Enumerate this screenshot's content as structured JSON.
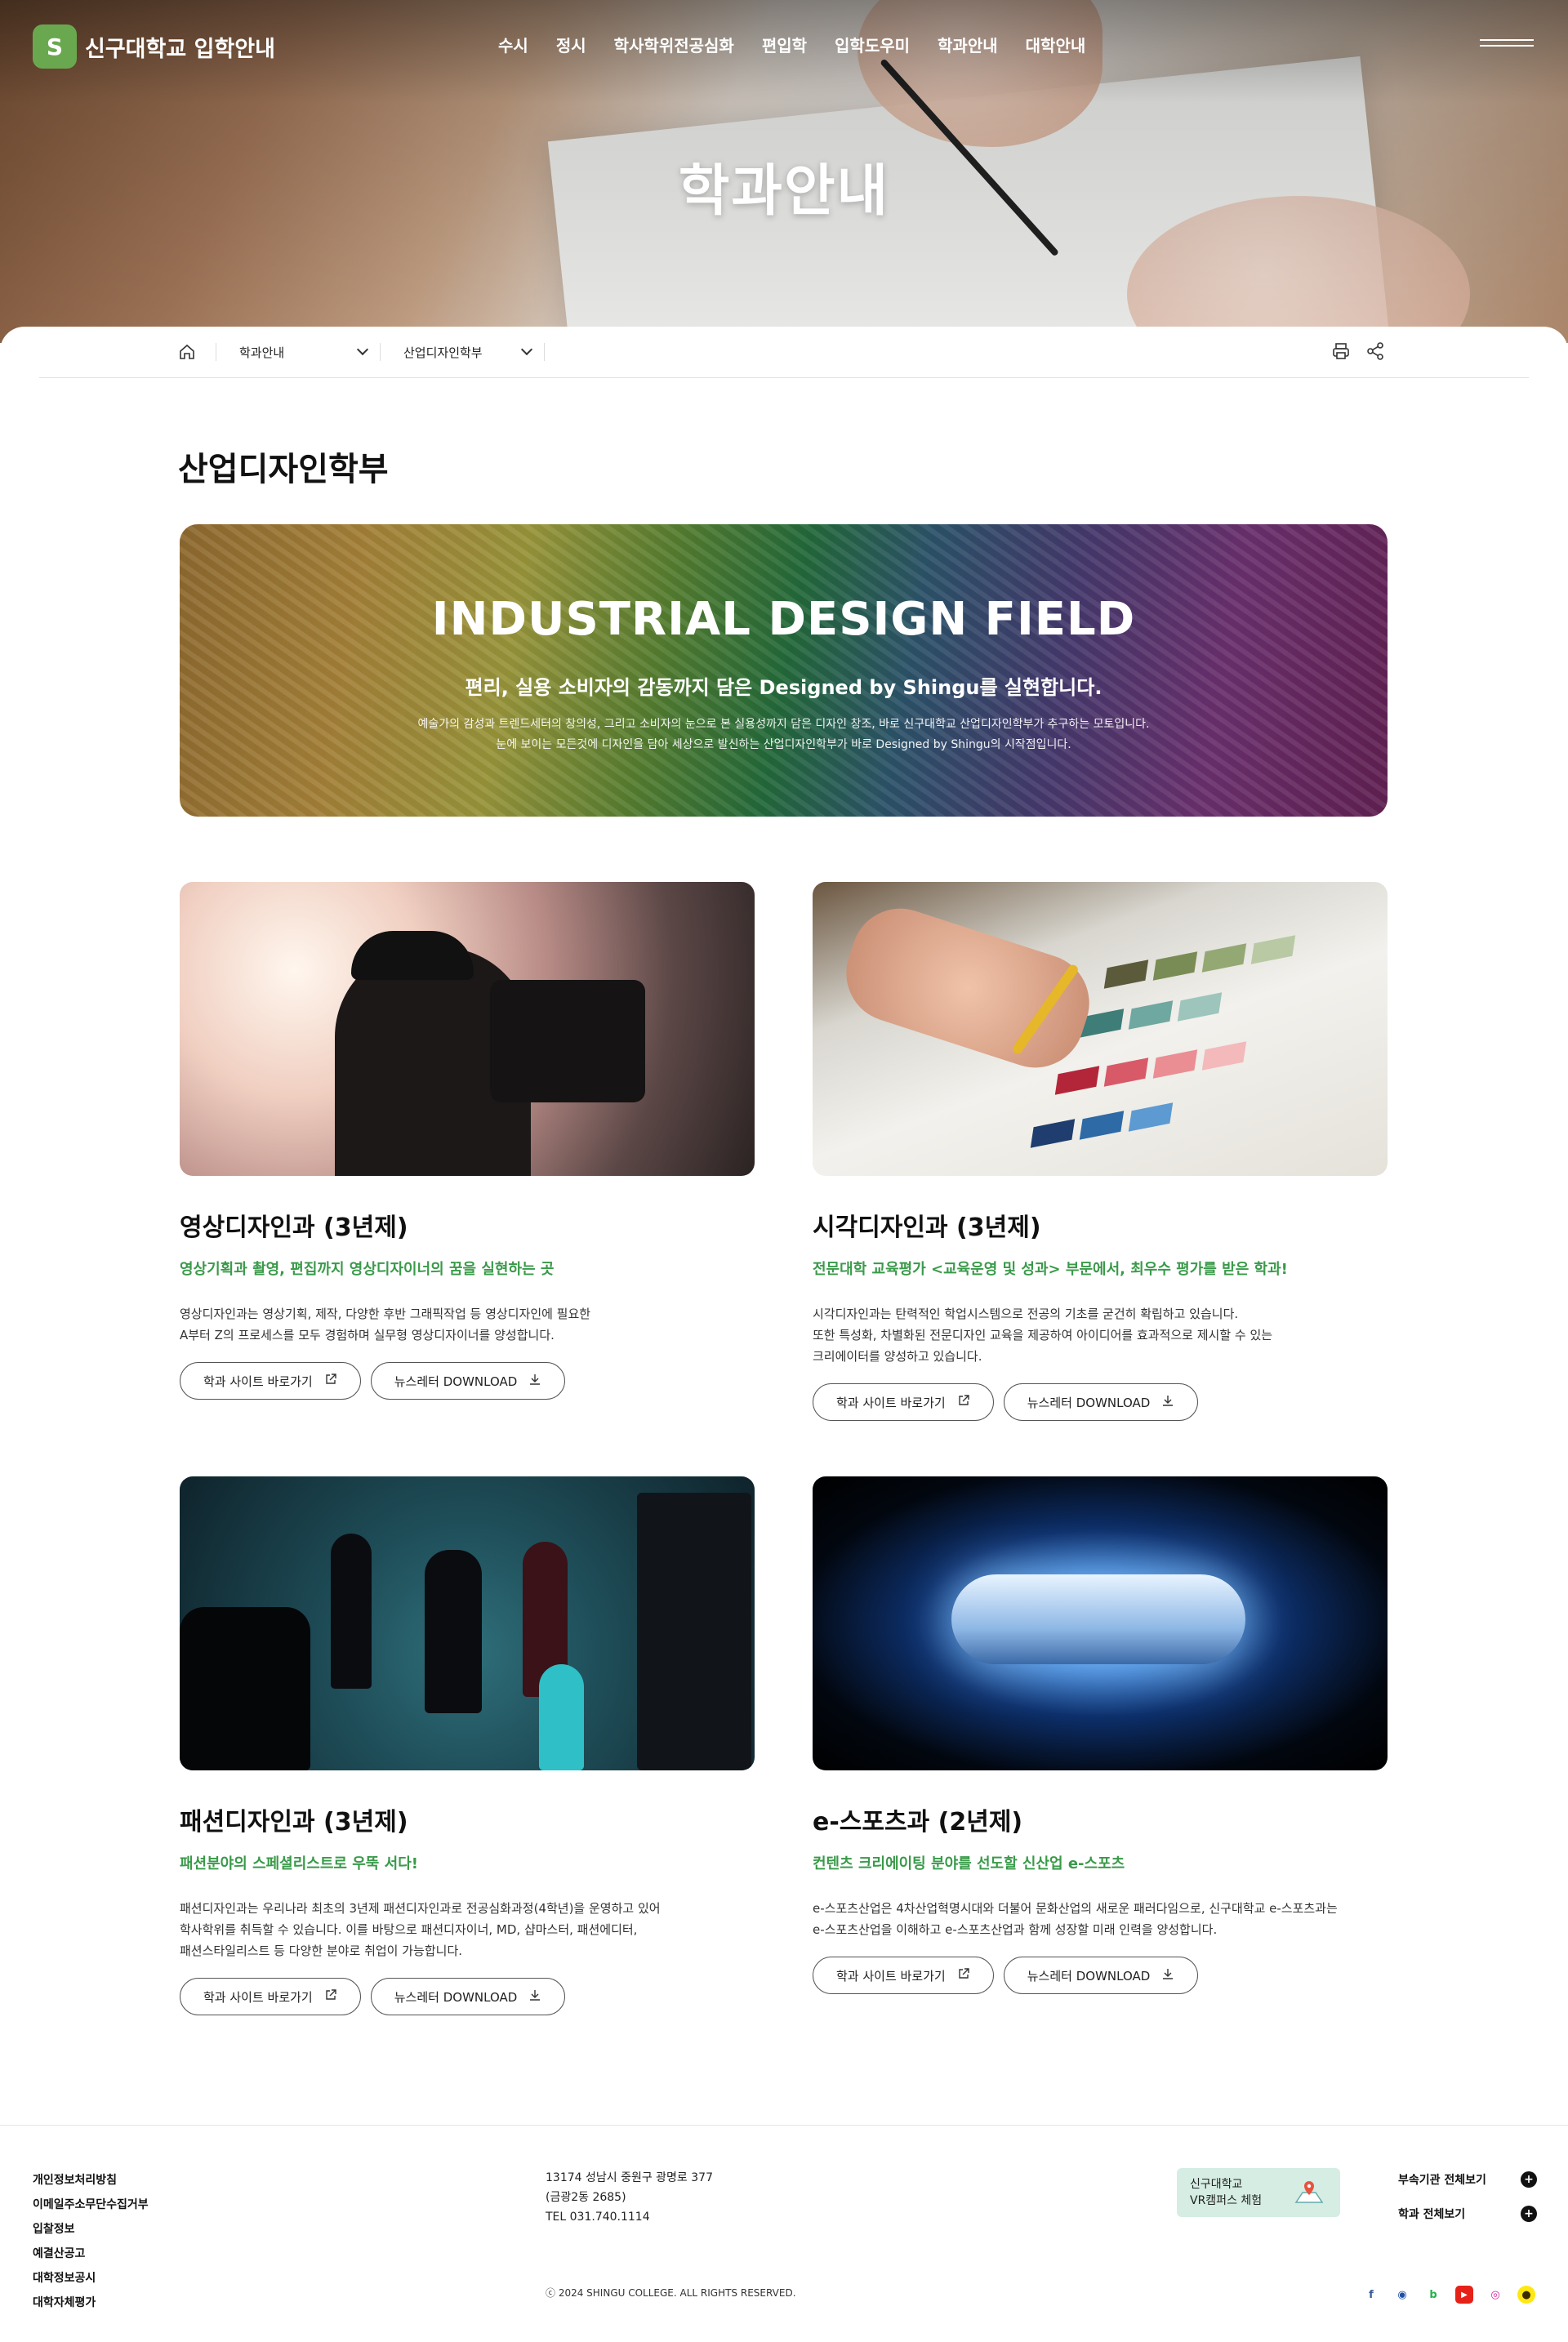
{
  "header": {
    "logo_text": "신구대학교 입학안내",
    "logo_mark": "S",
    "nav": [
      "수시",
      "정시",
      "학사학위전공심화",
      "편입학",
      "입학도우미",
      "학과안내",
      "대학안내"
    ],
    "hero_title": "학과안내"
  },
  "breadcrumb": {
    "level1": "학과안내",
    "level2": "산업디자인학부"
  },
  "page": {
    "title": "산업디자인학부"
  },
  "banner": {
    "title": "INDUSTRIAL DESIGN FIELD",
    "subtitle": "편리, 실용 소비자의 감동까지 담은 Designed by Shingu를 실현합니다.",
    "line1": "예술가의 감성과 트렌드세터의 창의성, 그리고 소비자의 눈으로 본 실용성까지 담은 디자인 창조, 바로 신구대학교 산업디자인학부가 추구하는 모토입니다.",
    "line2": "눈에 보이는 모든것에 디자인을 담아 세상으로 발신하는 산업디자인학부가 바로 Designed by Shingu의 시작점입니다."
  },
  "departments": [
    {
      "name": "영상디자인과 (3년제)",
      "tagline": "영상기획과 촬영, 편집까지 영상디자이너의 꿈을 실현하는 곳",
      "desc": [
        "영상디자인과는 영상기획, 제작, 다양한 후반 그래픽작업 등 영상디자인에 필요한",
        "A부터 Z의 프로세스를 모두 경험하며 실무형 영상디자이너를 양성합니다."
      ],
      "site_btn": "학과 사이트 바로가기",
      "news_btn": "뉴스레터 DOWNLOAD"
    },
    {
      "name": "시각디자인과 (3년제)",
      "tagline": "전문대학 교육평가 <교육운영 및 성과> 부문에서, 최우수 평가를 받은 학과!",
      "desc": [
        "시각디자인과는 탄력적인 학업시스템으로 전공의 기초를 굳건히 확립하고 있습니다.",
        "또한 특성화, 차별화된 전문디자인 교육을 제공하여 아이디어를 효과적으로 제시할 수 있는",
        "크리에이터를 양성하고 있습니다."
      ],
      "site_btn": "학과 사이트 바로가기",
      "news_btn": "뉴스레터 DOWNLOAD"
    },
    {
      "name": "패션디자인과 (3년제)",
      "tagline": "패션분야의 스페셜리스트로 우뚝 서다!",
      "desc": [
        "패션디자인과는 우리나라 최초의 3년제 패션디자인과로 전공심화과정(4학년)을 운영하고 있어",
        "학사학위를 취득할 수 있습니다. 이를 바탕으로 패션디자이너, MD, 샵마스터, 패션에디터,",
        "패션스타일리스트 등 다양한 분야로 취업이 가능합니다."
      ],
      "site_btn": "학과 사이트 바로가기",
      "news_btn": "뉴스레터 DOWNLOAD"
    },
    {
      "name": "e-스포츠과 (2년제)",
      "tagline": "컨텐츠 크리에이팅 분야를 선도할 신산업 e-스포츠",
      "desc": [
        "e-스포츠산업은 4차산업혁명시대와 더불어 문화산업의 새로운 패러다임으로, 신구대학교 e-스포츠과는",
        "e-스포츠산업을 이해하고 e-스포츠산업과 함께 성장할 미래 인력을 양성합니다."
      ],
      "site_btn": "학과 사이트 바로가기",
      "news_btn": "뉴스레터 DOWNLOAD"
    }
  ],
  "footer": {
    "links": [
      "개인정보처리방침",
      "이메일주소무단수집거부",
      "입찰정보",
      "예결산공고",
      "대학정보공시",
      "대학자체평가"
    ],
    "address1": "13174 성남시 중원구 광명로 377",
    "address2": "(금광2동 2685)",
    "tel": "TEL  031.740.1114",
    "copyright": "ⓒ 2024 SHINGU COLLEGE. ALL RIGHTS RESERVED.",
    "vr_line1": "신구대학교",
    "vr_line2": "VR캠퍼스 체험",
    "family1": "부속기관 전체보기",
    "family2": "학과 전체보기",
    "plus": "+",
    "socials": [
      {
        "icon": "facebook-icon",
        "glyph": "f",
        "color": "#3b5998"
      },
      {
        "icon": "blog-icon",
        "glyph": "◉",
        "color": "#1e4fa8"
      },
      {
        "icon": "band-icon",
        "glyph": "b",
        "color": "#22b24c"
      },
      {
        "icon": "youtube-icon",
        "glyph": "▶",
        "color": "#e62117"
      },
      {
        "icon": "instagram-icon",
        "glyph": "◎",
        "color": "#d6249f"
      },
      {
        "icon": "kakaotalk-icon",
        "glyph": "●",
        "color": "#3a2a00"
      }
    ]
  }
}
